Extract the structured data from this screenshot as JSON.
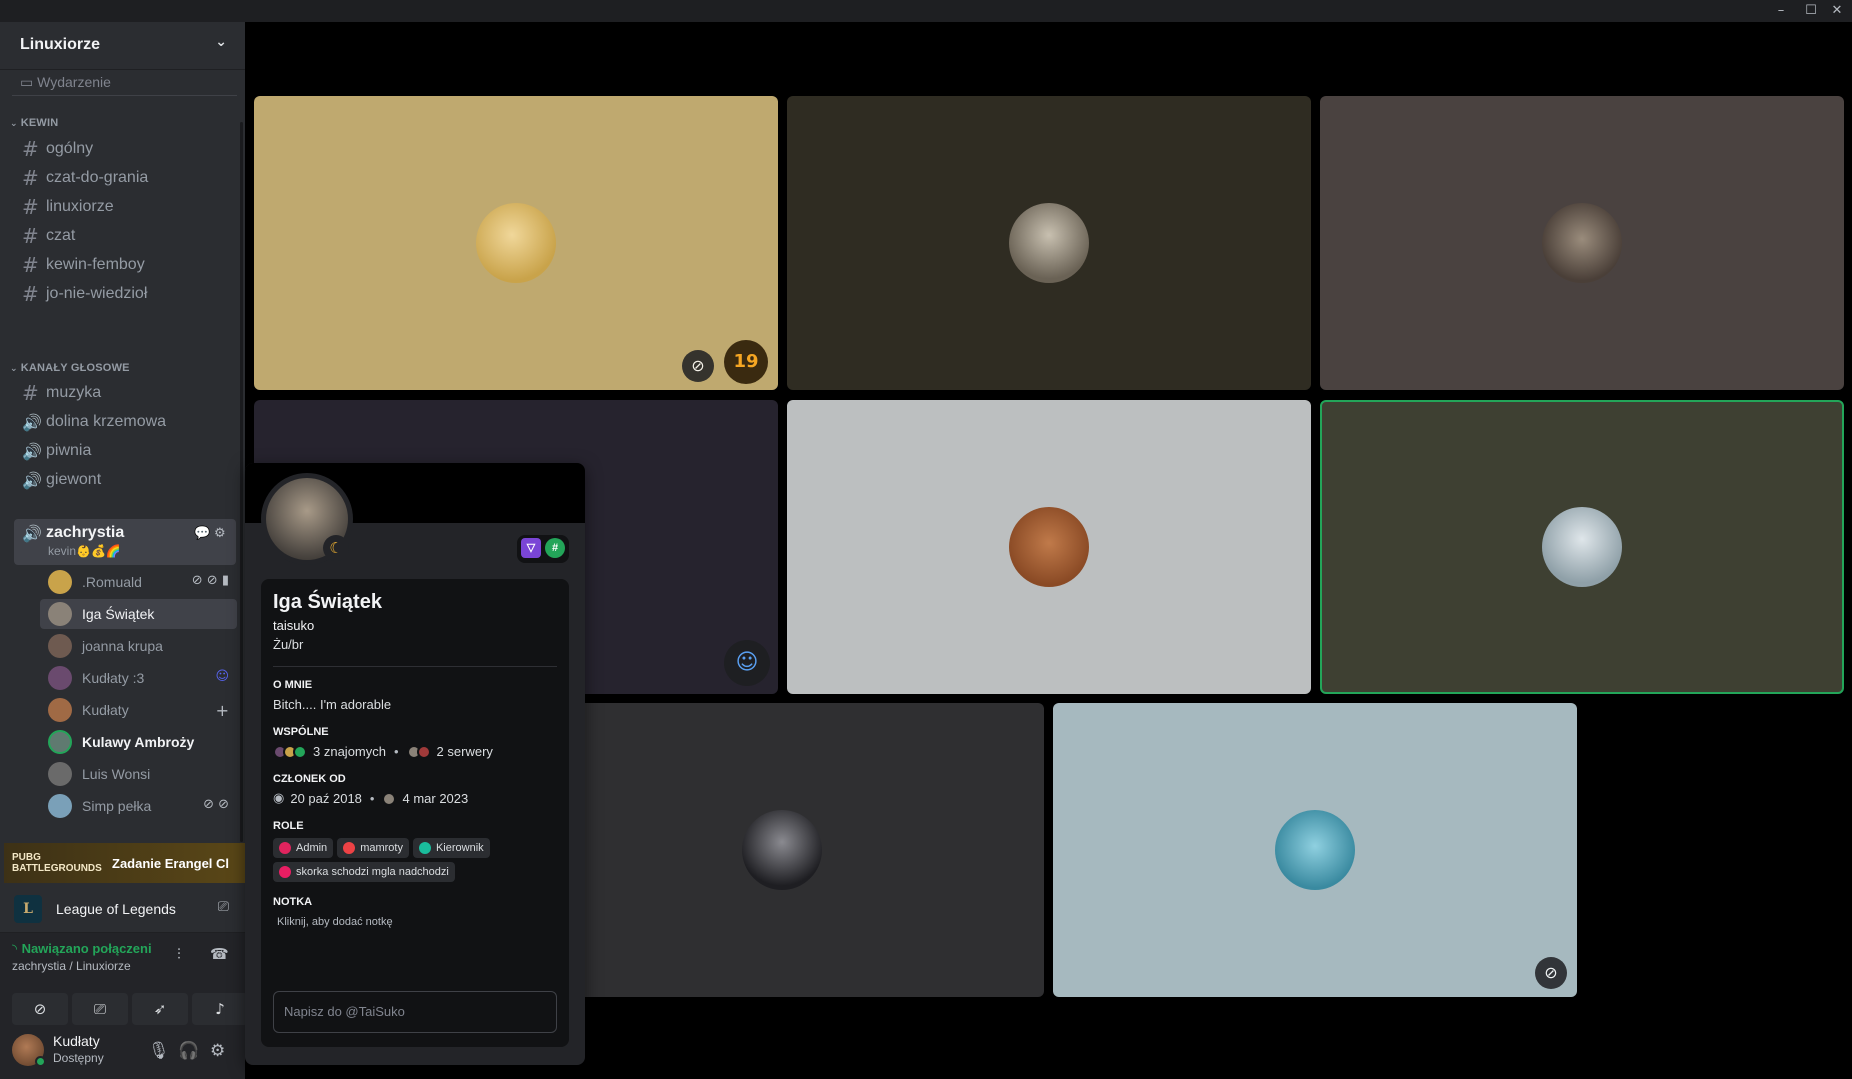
{
  "window": {
    "minimize": "–",
    "maximize": "☐",
    "close": "✕"
  },
  "server": {
    "name": "Linuxiorze",
    "partial_row": "Wydarzenie"
  },
  "categories": {
    "kewin": "KEWIN",
    "voice": "KANAŁY GŁOSOWE"
  },
  "text_channels": [
    "ogólny",
    "czat-do-grania",
    "linuxiorze",
    "czat",
    "kewin-femboy",
    "jo-nie-wiedzioł"
  ],
  "voice_channels": [
    "muzyka",
    "dolina krzemowa",
    "piwnia",
    "giewont"
  ],
  "active_voice": {
    "name": "zachrystia",
    "status": "kevin👶💰🌈"
  },
  "voice_users": [
    {
      "name": ".Romuald",
      "icons": "⊘ ⊘ ▮",
      "color": "#c9a34a"
    },
    {
      "name": "Iga Świątek",
      "icons": "",
      "color": "#8a8278"
    },
    {
      "name": "joanna krupa",
      "icons": "",
      "color": "#6e5a50"
    },
    {
      "name": "Kudłaty :3",
      "icons": "☺",
      "color": "#6a4a6e"
    },
    {
      "name": "Kudłaty",
      "icons": "+",
      "color": "#a06a45"
    },
    {
      "name": "Kulawy Ambroży",
      "icons": "",
      "color": "#5f7a70"
    },
    {
      "name": "Luis Wonsi",
      "icons": "",
      "color": "#6a6a6a"
    },
    {
      "name": "Simp pełka",
      "icons": "⊘ ⊘",
      "color": "#7aa0b8"
    }
  ],
  "activities": {
    "pubg_logo": "PUBG BATTLEGROUNDS",
    "pubg_title": "Zadanie Erangel Cl",
    "lol_logo": "L",
    "lol_title": "League of Legends"
  },
  "voice_status": {
    "connected": "Nawiązano połączeni",
    "location": "zachrystia / Linuxiorze"
  },
  "user": {
    "name": "Kudłaty",
    "status": "Dostępny"
  },
  "tiles": [
    {
      "bg": "#bfa96f",
      "av": "#d8b763"
    },
    {
      "bg": "#2f2c22",
      "av": "#8a8170"
    },
    {
      "bg": "#4a4240",
      "av": "#7a7065"
    },
    {
      "bg": "#26232e",
      "av": ""
    },
    {
      "bg": "#bcbfc0",
      "av": "#9a5a3a"
    },
    {
      "bg": "#3e4032",
      "av": "#b7c2c8"
    },
    {
      "bg": "#2f2f31",
      "av": "#3a3a3e"
    },
    {
      "bg": "#a6b9bf",
      "av": "#5a9fb0"
    }
  ],
  "tile_badges": {
    "t1_mute": "⊘",
    "t1_num": "19",
    "t4_icon": "☺",
    "t8_mute": "⊘"
  },
  "profile": {
    "name": "Iga Świątek",
    "username": "taisuko",
    "pronouns": "Żu/br",
    "about_label": "O MNIE",
    "about": "Bitch.... I'm adorable",
    "mutual_label": "WSPÓLNE",
    "friends": "3 znajomych",
    "servers": "2 serwery",
    "member_label": "CZŁONEK OD",
    "discord_since": "20 paź 2018",
    "server_since": "4 mar 2023",
    "roles_label": "ROLE",
    "roles": [
      {
        "name": "Admin",
        "color": "#e0245e"
      },
      {
        "name": "mamroty",
        "color": "#ed4245"
      },
      {
        "name": "Kierownik",
        "color": "#1abc9c"
      },
      {
        "name": "skorka schodzi mgla nadchodzi",
        "color": "#e91e63"
      }
    ],
    "note_label": "NOTKA",
    "note_placeholder": "Kliknij, aby dodać notkę",
    "message_placeholder": "Napisz do @TaiSuko"
  }
}
